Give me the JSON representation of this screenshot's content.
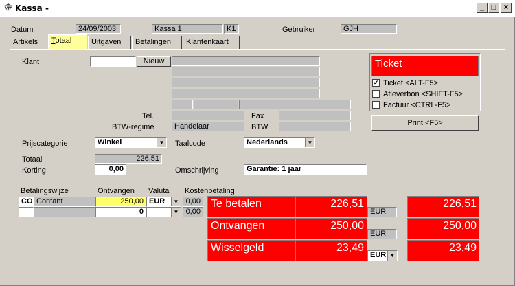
{
  "window": {
    "title": "Kassa -",
    "icon": "diamond-app-icon",
    "min_glyph": "_",
    "max_glyph": "□",
    "close_glyph": "×"
  },
  "header": {
    "datum_label": "Datum",
    "datum_value": "24/09/2003",
    "kassa_value": "Kassa 1",
    "kassa_code": "K1",
    "gebruiker_label": "Gebruiker",
    "gebruiker_value": "GJH"
  },
  "tabs": [
    {
      "label": "Artikels",
      "accel": "A"
    },
    {
      "label": "Totaal",
      "accel": "T"
    },
    {
      "label": "Uitgaven",
      "accel": "U"
    },
    {
      "label": "Betalingen",
      "accel": "B"
    },
    {
      "label": "Klantenkaart",
      "accel": "K"
    }
  ],
  "klant": {
    "label": "Klant",
    "value": "",
    "new_button": "Nieuw"
  },
  "tel_label": "Tel.",
  "fax_label": "Fax",
  "btw_regime_label": "BTW-regime",
  "btw_regime_value": "Handelaar",
  "btw_label": "BTW",
  "prijscategorie_label": "Prijscategorie",
  "prijscategorie_value": "Winkel",
  "taalcode_label": "Taalcode",
  "taalcode_value": "Nederlands",
  "totaal_label": "Totaal",
  "totaal_value": "226,51",
  "korting_label": "Korting",
  "korting_value": "0,00",
  "omschrijving_label": "Omschrijving",
  "omschrijving_value": "Garantie: 1 jaar",
  "ticket": {
    "title": "Ticket",
    "options": [
      {
        "label": "Ticket <ALT-F5>",
        "checked": true
      },
      {
        "label": "Afleverbon <SHIFT-F5>",
        "checked": false
      },
      {
        "label": "Factuur <CTRL-F5>",
        "checked": false
      }
    ],
    "print_button": "Print <F5>"
  },
  "payments": {
    "headers": {
      "betalingswijze": "Betalingswijze",
      "ontvangen": "Ontvangen",
      "valuta": "Valuta",
      "kostenbetaling": "Kostenbetaling"
    },
    "rows": [
      {
        "code": "CO",
        "name": "Contant",
        "amount": "250,00",
        "currency": "EUR",
        "cost": "0,00"
      },
      {
        "code": "",
        "name": "",
        "amount": "0",
        "currency": "",
        "cost": "0,00"
      }
    ]
  },
  "summary": {
    "te_betalen_label": "Te betalen",
    "te_betalen_value": "226,51",
    "te_betalen_currency": "EUR",
    "te_betalen_alt": "226,51",
    "ontvangen_label": "Ontvangen",
    "ontvangen_value": "250,00",
    "ontvangen_currency": "EUR",
    "ontvangen_alt": "250,00",
    "wisselgeld_label": "Wisselgeld",
    "wisselgeld_value": "23,49",
    "wisselgeld_currency": "EUR",
    "wisselgeld_alt": "23,49"
  },
  "colors": {
    "accent_red": "#ff0000",
    "active_tab": "#ffff99",
    "amount_highlight": "#ffff66"
  }
}
